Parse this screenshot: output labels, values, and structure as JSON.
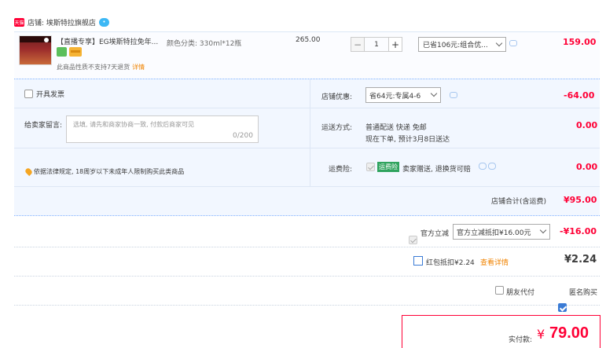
{
  "store": {
    "badge": "天猫",
    "name": "店铺: 埃斯特拉旗舰店"
  },
  "item": {
    "title": "【直播专享】EG埃斯特拉免年...",
    "spec": "颜色分类: 330ml*12瓶",
    "unit_price": "265.00",
    "quantity": "1",
    "qty_minus": "−",
    "qty_plus": "+",
    "promo_selected": "已省106元:组合优...",
    "subtotal": "159.00",
    "notice": "此商品性质不支持7天退货",
    "notice_link": "详情"
  },
  "options": {
    "invoice_label": "开具发票",
    "message_label": "给卖家留言:",
    "message_placeholder": "选填, 请先和商家协商一致, 付款后商家可见",
    "message_count": "0/200",
    "law_notice": "依据法律规定, 18周岁以下未成年人限制购买此类商品",
    "shop_discount_label": "店铺优惠:",
    "shop_discount_selected": "省64元:专属4-6",
    "shop_discount_amount": "-64.00",
    "shipping_label": "运送方式:",
    "shipping_line1": "普通配送 快递 免邮",
    "shipping_line2": "现在下单, 预计3月8日送达",
    "shipping_amount": "0.00",
    "insurance_label": "运费险:",
    "insurance_badge": "运费险",
    "insurance_text": "卖家赠送, 退换货可赔",
    "insurance_amount": "0.00"
  },
  "shop_total": {
    "label": "店铺合计(含运费)",
    "amount": "¥95.00"
  },
  "gov_discount": {
    "label": "官方立减",
    "selected": "官方立减抵扣¥16.00元",
    "amount": "-¥16.00"
  },
  "red_packet": {
    "label": "红包抵扣¥2.24",
    "link": "查看详情",
    "amount": "¥2.24"
  },
  "extra": {
    "friend_pay": "朋友代付",
    "anonymous": "匿名购买"
  },
  "payment": {
    "label": "实付款:",
    "currency": "¥",
    "amount": "79.00"
  },
  "colors": {
    "accent": "#ff0036",
    "link": "#f08300",
    "panel": "#f2f7ff"
  }
}
